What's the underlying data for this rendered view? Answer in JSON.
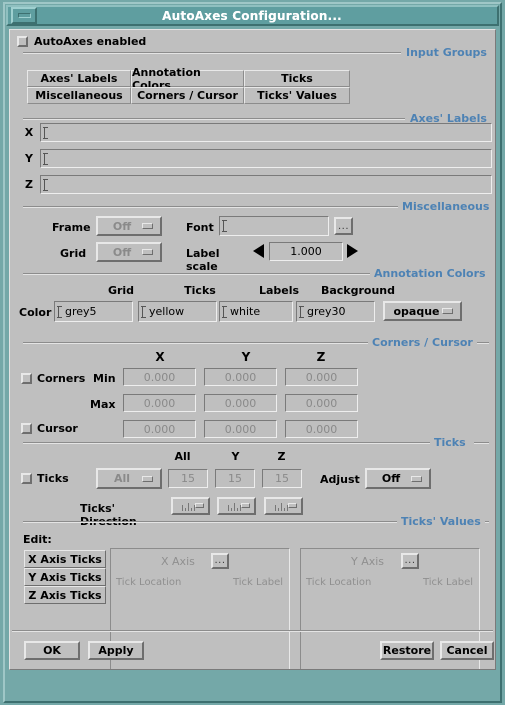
{
  "window": {
    "title": "AutoAxes Configuration...",
    "minimize_icon": "minimize-icon",
    "title_bar_color": "#5f9ea0",
    "frame_color": "#74a8a8",
    "form_background": "#bfbfbf",
    "section_label_color": "#4d82b4"
  },
  "enable": {
    "label": "AutoAxes enabled",
    "checked": false
  },
  "sections": {
    "input_groups": "Input Groups",
    "axes_labels": "Axes' Labels",
    "miscellaneous": "Miscellaneous",
    "annotation_colors": "Annotation Colors",
    "corners_cursor": "Corners / Cursor",
    "ticks": "Ticks",
    "ticks_values": "Ticks' Values"
  },
  "input_groups": {
    "buttons": [
      "Axes' Labels",
      "Annotation Colors",
      "Ticks",
      "Miscellaneous",
      "Corners / Cursor",
      "Ticks' Values"
    ]
  },
  "axes_labels": {
    "rows": [
      {
        "label": "X",
        "value": ""
      },
      {
        "label": "Y",
        "value": ""
      },
      {
        "label": "Z",
        "value": ""
      }
    ]
  },
  "miscellaneous": {
    "frame_label": "Frame",
    "frame_value": "Off",
    "grid_label": "Grid",
    "grid_value": "Off",
    "font_label": "Font",
    "font_value": "",
    "font_browse_label": "...",
    "label_scale_label": "Label scale",
    "label_scale_value": "1.000",
    "decrement_icon": "arrow-left-icon",
    "increment_icon": "arrow-right-icon"
  },
  "annotation_colors": {
    "row_label": "Color",
    "headers": [
      "Grid",
      "Ticks",
      "Labels",
      "Background"
    ],
    "values": [
      "grey5",
      "yellow",
      "white",
      "grey30"
    ],
    "opacity_value": "opaque"
  },
  "corners_cursor": {
    "headers": [
      "X",
      "Y",
      "Z"
    ],
    "corners_label": "Corners",
    "corners_checked": false,
    "min_label": "Min",
    "max_label": "Max",
    "min_values": [
      "0.000",
      "0.000",
      "0.000"
    ],
    "max_values": [
      "0.000",
      "0.000",
      "0.000"
    ],
    "cursor_label": "Cursor",
    "cursor_checked": false,
    "cursor_values": [
      "0.000",
      "0.000",
      "0.000"
    ]
  },
  "ticks": {
    "ticks_label": "Ticks",
    "ticks_checked": false,
    "mode_value": "All",
    "headers": [
      "All",
      "Y",
      "Z"
    ],
    "counts": [
      "15",
      "15",
      "15"
    ],
    "adjust_label": "Adjust",
    "adjust_value": "Off",
    "direction_label": "Ticks' Direction",
    "direction_icons": [
      "tick-direction-icon",
      "tick-direction-icon",
      "tick-direction-icon"
    ]
  },
  "ticks_values": {
    "edit_label": "Edit:",
    "edit_buttons": [
      "X Axis Ticks",
      "Y Axis Ticks",
      "Z Axis Ticks"
    ],
    "panes": [
      {
        "title": "X Axis",
        "browse_label": "...",
        "col_location": "Tick Location",
        "col_label": "Tick Label",
        "rows": []
      },
      {
        "title": "Y Axis",
        "browse_label": "...",
        "col_location": "Tick Location",
        "col_label": "Tick Label",
        "rows": []
      }
    ]
  },
  "footer": {
    "ok": "OK",
    "apply": "Apply",
    "restore": "Restore",
    "cancel": "Cancel"
  }
}
